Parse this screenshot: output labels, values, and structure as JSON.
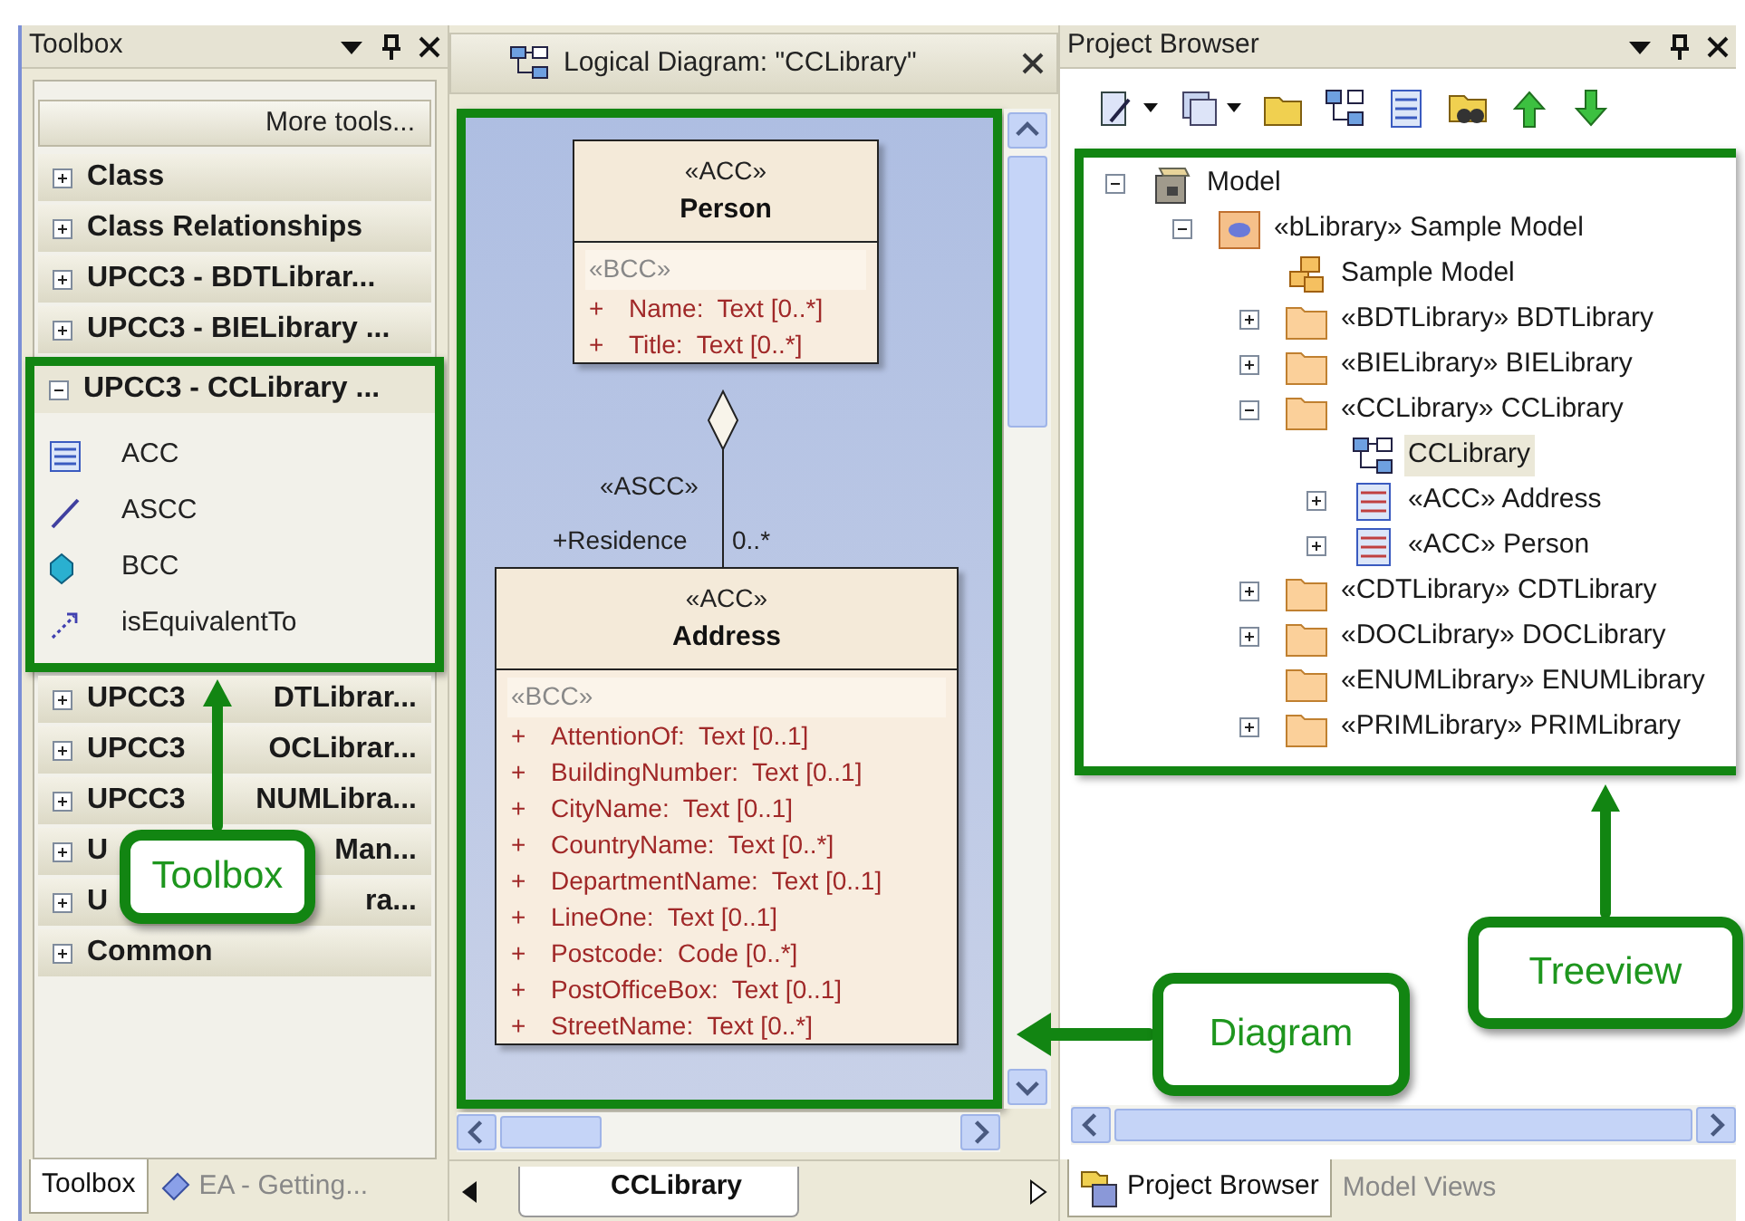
{
  "toolbox": {
    "title": "Toolbox",
    "more_tools": "More tools...",
    "groups": [
      {
        "label": "Class",
        "expanded": false
      },
      {
        "label": "Class Relationships",
        "expanded": false
      },
      {
        "label": "UPCC3 - BDTLibrar...",
        "expanded": false
      },
      {
        "label": "UPCC3 - BIELibrary ...",
        "expanded": false
      },
      {
        "label": "UPCC3 - CCLibrary ...",
        "expanded": true,
        "items": [
          {
            "label": "ACC",
            "kind": "class"
          },
          {
            "label": "ASCC",
            "kind": "association"
          },
          {
            "label": "BCC",
            "kind": "attribute"
          },
          {
            "label": "isEquivalentTo",
            "kind": "dependency"
          }
        ]
      },
      {
        "label": "UPCC3",
        "label_end": "DTLibrar...",
        "expanded": false
      },
      {
        "label": "UPCC3",
        "label_end": "OCLibrar...",
        "expanded": false
      },
      {
        "label": "UPCC3",
        "label_end": "NUMLibra...",
        "expanded": false
      },
      {
        "label": "U",
        "label_end": "Man...",
        "expanded": false
      },
      {
        "label": "U",
        "label_end": "ra...",
        "expanded": false
      },
      {
        "label": "Common",
        "expanded": false
      }
    ],
    "tabs": [
      {
        "label": "Toolbox",
        "kind": "plain",
        "selected": true
      },
      {
        "label": "EA - Getting...",
        "kind": "guide",
        "selected": false
      }
    ]
  },
  "diagram": {
    "title": "Logical Diagram: \"CCLibrary\"",
    "classes": [
      {
        "stereotype": "«ACC»",
        "name": "Person",
        "attr_stereotype": "«BCC»",
        "attributes": [
          {
            "visibility": "+",
            "text": "Name:  Text [0..*]"
          },
          {
            "visibility": "+",
            "text": "Title:  Text [0..*]"
          }
        ]
      },
      {
        "stereotype": "«ACC»",
        "name": "Address",
        "attr_stereotype": "«BCC»",
        "attributes": [
          {
            "visibility": "+",
            "text": "AttentionOf:  Text [0..1]"
          },
          {
            "visibility": "+",
            "text": "BuildingNumber:  Text [0..1]"
          },
          {
            "visibility": "+",
            "text": "CityName:  Text [0..1]"
          },
          {
            "visibility": "+",
            "text": "CountryName:  Text [0..*]"
          },
          {
            "visibility": "+",
            "text": "DepartmentName:  Text [0..1]"
          },
          {
            "visibility": "+",
            "text": "LineOne:  Text [0..1]"
          },
          {
            "visibility": "+",
            "text": "Postcode:  Code [0..*]"
          },
          {
            "visibility": "+",
            "text": "PostOfficeBox:  Text [0..1]"
          },
          {
            "visibility": "+",
            "text": "StreetName:  Text [0..*]"
          }
        ]
      }
    ],
    "association": {
      "stereotype": "«ASCC»",
      "role": "+Residence",
      "multiplicity": "0..*"
    },
    "tabs": [
      {
        "label": "CCLibrary",
        "selected": true
      }
    ]
  },
  "project_browser": {
    "title": "Project Browser",
    "tree": [
      {
        "label": "Model",
        "kind": "model",
        "expanded": true,
        "selected": false,
        "children": [
          {
            "label": "«bLibrary» Sample Model",
            "kind": "library",
            "expanded": true,
            "selected": false,
            "children": [
              {
                "label": "Sample Model",
                "kind": "component",
                "selected": false
              },
              {
                "label": "«BDTLibrary» BDTLibrary",
                "kind": "folder",
                "expanded": false,
                "selected": false
              },
              {
                "label": "«BIELibrary» BIELibrary",
                "kind": "folder",
                "expanded": false,
                "selected": false
              },
              {
                "label": "«CCLibrary» CCLibrary",
                "kind": "folder",
                "expanded": true,
                "selected": false,
                "children": [
                  {
                    "label": "CCLibrary",
                    "kind": "diagram",
                    "selected": true
                  },
                  {
                    "label": "«ACC» Address",
                    "kind": "class",
                    "expanded": false,
                    "selected": false
                  },
                  {
                    "label": "«ACC» Person",
                    "kind": "class",
                    "expanded": false,
                    "selected": false
                  }
                ]
              },
              {
                "label": "«CDTLibrary» CDTLibrary",
                "kind": "folder",
                "expanded": false,
                "selected": false
              },
              {
                "label": "«DOCLibrary» DOCLibrary",
                "kind": "folder",
                "expanded": false,
                "selected": false
              },
              {
                "label": "«ENUMLibrary» ENUMLibrary",
                "kind": "folder",
                "selected": false
              },
              {
                "label": "«PRIMLibrary» PRIMLibrary",
                "kind": "folder",
                "expanded": false,
                "selected": false
              }
            ]
          }
        ]
      }
    ],
    "tabs": [
      {
        "label": "Project Browser",
        "kind": "browser",
        "selected": true
      },
      {
        "label": "Model Views",
        "kind": "plain",
        "selected": false
      }
    ]
  },
  "callouts": [
    {
      "label": "Toolbox"
    },
    {
      "label": "Diagram"
    },
    {
      "label": "Treeview"
    }
  ]
}
